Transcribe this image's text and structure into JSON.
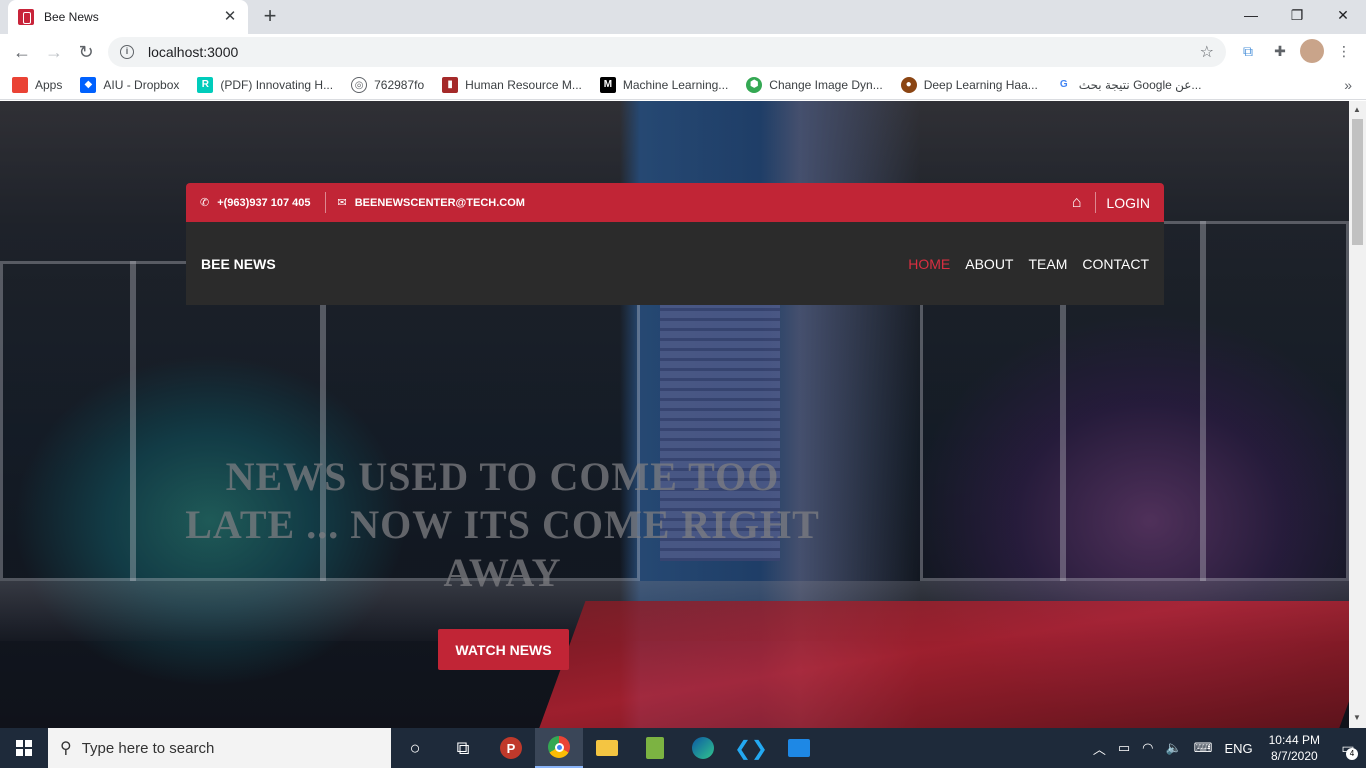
{
  "browser": {
    "tab_title": "Bee News",
    "url": "localhost:3000",
    "bookmarks": [
      {
        "label": "Apps",
        "color": "#4285f4"
      },
      {
        "label": "AIU - Dropbox",
        "color": "#0061fe"
      },
      {
        "label": "(PDF) Innovating H...",
        "color": "#00ccbb"
      },
      {
        "label": "762987fo",
        "color": "#5f6368"
      },
      {
        "label": "Human Resource M...",
        "color": "#a52a2a"
      },
      {
        "label": "Machine Learning...",
        "color": "#000000"
      },
      {
        "label": "Change Image Dyn...",
        "color": "#34a853"
      },
      {
        "label": "Deep Learning Haa...",
        "color": "#8b4513"
      },
      {
        "label": "نتيجة بحث Google عن...",
        "color": "#4285f4"
      }
    ]
  },
  "site": {
    "phone": "+(963)937 107 405",
    "email": "BEENEWSCENTER@TECH.COM",
    "login": "LOGIN",
    "brand": "BEE NEWS",
    "nav": {
      "home": "HOME",
      "about": "ABOUT",
      "team": "TEAM",
      "contact": "CONTACT"
    },
    "hero_title": "NEWS USED TO COME TOO LATE ... NOW ITS COME RIGHT AWAY",
    "watch_button": "WATCH NEWS",
    "accent_color": "#c12536"
  },
  "taskbar": {
    "search_placeholder": "Type here to search",
    "language": "ENG",
    "time": "10:44 PM",
    "date": "8/7/2020",
    "notification_count": "4"
  }
}
